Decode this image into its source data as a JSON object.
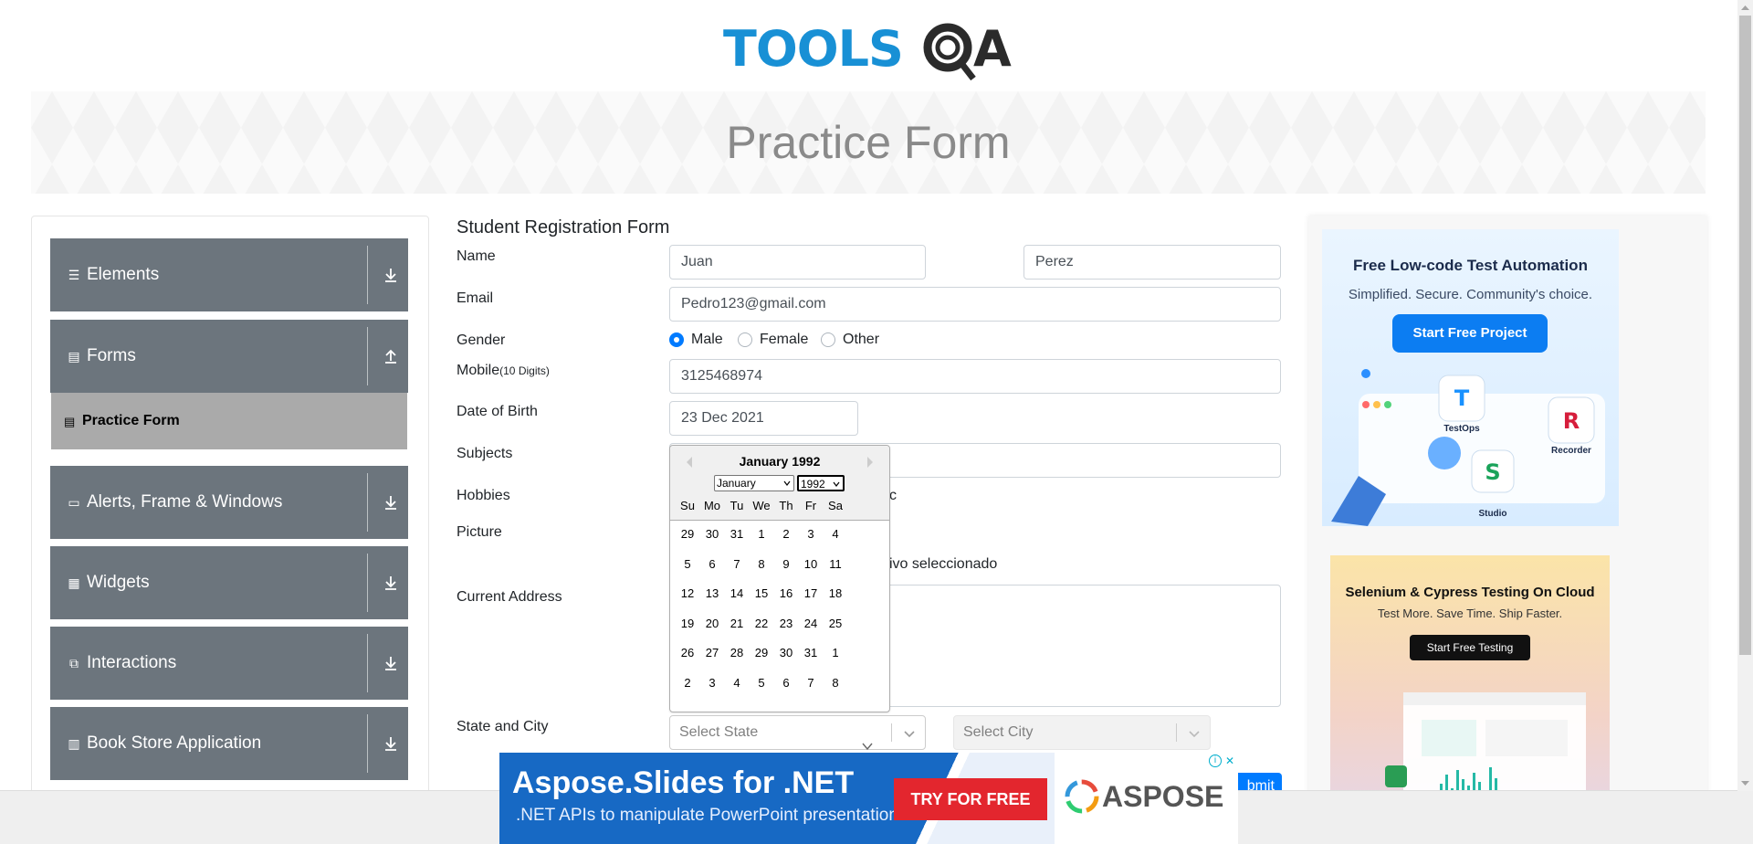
{
  "header": {
    "logo_text": "TOOLSQA",
    "page_title": "Practice Form"
  },
  "sidebar": {
    "groups": [
      {
        "label": "Elements",
        "icon": "hamburger-icon"
      },
      {
        "label": "Forms",
        "icon": "document-icon"
      },
      {
        "label": "Alerts, Frame & Windows",
        "icon": "window-icon"
      },
      {
        "label": "Widgets",
        "icon": "grid-icon"
      },
      {
        "label": "Interactions",
        "icon": "interaction-icon"
      },
      {
        "label": "Book Store Application",
        "icon": "library-icon"
      }
    ],
    "active_item": "Practice Form"
  },
  "form": {
    "title": "Student Registration Form",
    "labels": {
      "name": "Name",
      "email": "Email",
      "gender": "Gender",
      "mobile": "Mobile",
      "mobile_hint": "(10 Digits)",
      "dob": "Date of Birth",
      "subjects": "Subjects",
      "hobbies": "Hobbies",
      "picture": "Picture",
      "address": "Current Address",
      "state_city": "State and City"
    },
    "first_name": "Juan",
    "last_name": "Perez",
    "email": "Pedro123@gmail.com",
    "gender_options": [
      "Male",
      "Female",
      "Other"
    ],
    "gender_selected": "Male",
    "mobile": "3125468974",
    "dob": "23 Dec 2021",
    "hobby_partial": "c",
    "file_partial": "ivo seleccionado",
    "state_placeholder": "Select State",
    "city_placeholder": "Select City",
    "submit_label": "Submit",
    "submit_partial": "bmit"
  },
  "datepicker": {
    "header": "January 1992",
    "month_selected": "January",
    "year_selected": "1992",
    "day_names": [
      "Su",
      "Mo",
      "Tu",
      "We",
      "Th",
      "Fr",
      "Sa"
    ],
    "weeks": [
      [
        "29",
        "30",
        "31",
        "1",
        "2",
        "3",
        "4"
      ],
      [
        "5",
        "6",
        "7",
        "8",
        "9",
        "10",
        "11"
      ],
      [
        "12",
        "13",
        "14",
        "15",
        "16",
        "17",
        "18"
      ],
      [
        "19",
        "20",
        "21",
        "22",
        "23",
        "24",
        "25"
      ],
      [
        "26",
        "27",
        "28",
        "29",
        "30",
        "31",
        "1"
      ],
      [
        "2",
        "3",
        "4",
        "5",
        "6",
        "7",
        "8"
      ]
    ]
  },
  "ads": {
    "right_top": {
      "title": "Free Low-code Test Automation",
      "subtitle": "Simplified. Secure. Community's choice.",
      "button": "Start Free Project",
      "labels": [
        "TestOps",
        "Recorder",
        "Studio"
      ]
    },
    "right_bottom": {
      "title": "Selenium & Cypress Testing On Cloud",
      "subtitle": "Test More. Save Time. Ship Faster.",
      "button": "Start Free Testing"
    },
    "bottom": {
      "headline": "Aspose.Slides for .NET",
      "subline": ".NET APIs to manipulate PowerPoint presentations",
      "cta": "TRY FOR FREE",
      "brand": "ASPOSE"
    }
  },
  "colors": {
    "accent": "#007bff",
    "menu_bg": "#6c757d",
    "logo_blue": "#1890d5"
  }
}
